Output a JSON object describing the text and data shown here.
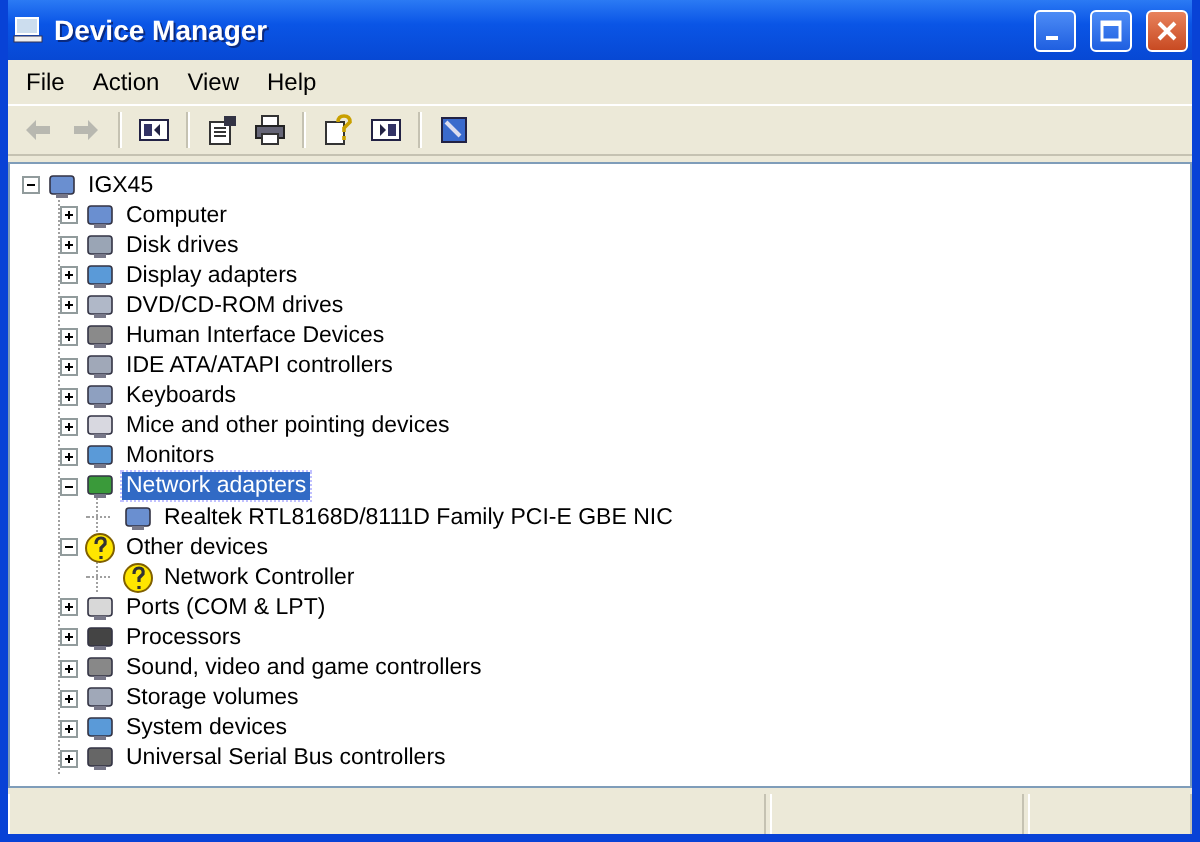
{
  "window": {
    "title": "Device Manager"
  },
  "menu": [
    "File",
    "Action",
    "View",
    "Help"
  ],
  "navigation": {
    "back_disabled": true,
    "forward_disabled": true
  },
  "tree": {
    "label": "IGX45",
    "expanded": true,
    "selected": false,
    "problem": false,
    "children": [
      {
        "label": "Computer",
        "expanded": false,
        "selected": false,
        "problem": false
      },
      {
        "label": "Disk drives",
        "expanded": false,
        "selected": false,
        "problem": false
      },
      {
        "label": "Display adapters",
        "expanded": false,
        "selected": false,
        "problem": false
      },
      {
        "label": "DVD/CD-ROM drives",
        "expanded": false,
        "selected": false,
        "problem": false
      },
      {
        "label": "Human Interface Devices",
        "expanded": false,
        "selected": false,
        "problem": false
      },
      {
        "label": "IDE ATA/ATAPI controllers",
        "expanded": false,
        "selected": false,
        "problem": false
      },
      {
        "label": "Keyboards",
        "expanded": false,
        "selected": false,
        "problem": false
      },
      {
        "label": "Mice and other pointing devices",
        "expanded": false,
        "selected": false,
        "problem": false
      },
      {
        "label": "Monitors",
        "expanded": false,
        "selected": false,
        "problem": false
      },
      {
        "label": "Network adapters",
        "expanded": true,
        "selected": true,
        "problem": false,
        "children": [
          {
            "label": "Realtek RTL8168D/8111D Family PCI-E GBE NIC",
            "selected": false,
            "problem": false
          }
        ]
      },
      {
        "label": "Other devices",
        "expanded": true,
        "selected": false,
        "problem": true,
        "children": [
          {
            "label": "Network Controller",
            "selected": false,
            "problem": true
          }
        ]
      },
      {
        "label": "Ports (COM & LPT)",
        "expanded": false,
        "selected": false,
        "problem": false
      },
      {
        "label": "Processors",
        "expanded": false,
        "selected": false,
        "problem": false
      },
      {
        "label": "Sound, video and game controllers",
        "expanded": false,
        "selected": false,
        "problem": false
      },
      {
        "label": "Storage volumes",
        "expanded": false,
        "selected": false,
        "problem": false
      },
      {
        "label": "System devices",
        "expanded": false,
        "selected": false,
        "problem": false
      },
      {
        "label": "Universal Serial Bus controllers",
        "expanded": false,
        "selected": false,
        "problem": false
      }
    ]
  }
}
